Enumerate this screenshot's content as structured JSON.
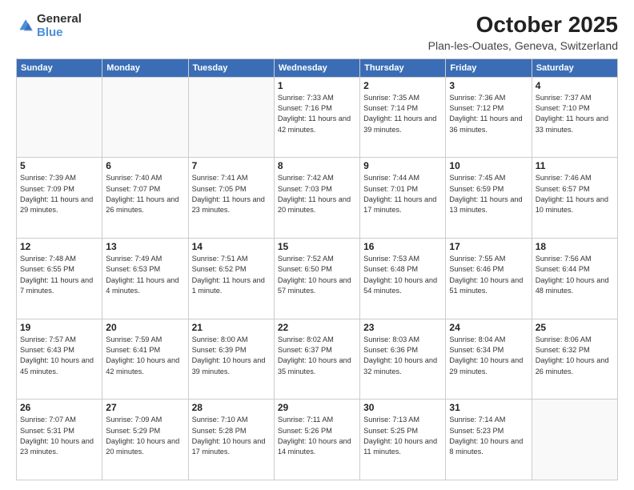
{
  "header": {
    "logo_general": "General",
    "logo_blue": "Blue",
    "month": "October 2025",
    "location": "Plan-les-Ouates, Geneva, Switzerland"
  },
  "weekdays": [
    "Sunday",
    "Monday",
    "Tuesday",
    "Wednesday",
    "Thursday",
    "Friday",
    "Saturday"
  ],
  "weeks": [
    [
      {
        "day": "",
        "info": ""
      },
      {
        "day": "",
        "info": ""
      },
      {
        "day": "",
        "info": ""
      },
      {
        "day": "1",
        "info": "Sunrise: 7:33 AM\nSunset: 7:16 PM\nDaylight: 11 hours and 42 minutes."
      },
      {
        "day": "2",
        "info": "Sunrise: 7:35 AM\nSunset: 7:14 PM\nDaylight: 11 hours and 39 minutes."
      },
      {
        "day": "3",
        "info": "Sunrise: 7:36 AM\nSunset: 7:12 PM\nDaylight: 11 hours and 36 minutes."
      },
      {
        "day": "4",
        "info": "Sunrise: 7:37 AM\nSunset: 7:10 PM\nDaylight: 11 hours and 33 minutes."
      }
    ],
    [
      {
        "day": "5",
        "info": "Sunrise: 7:39 AM\nSunset: 7:09 PM\nDaylight: 11 hours and 29 minutes."
      },
      {
        "day": "6",
        "info": "Sunrise: 7:40 AM\nSunset: 7:07 PM\nDaylight: 11 hours and 26 minutes."
      },
      {
        "day": "7",
        "info": "Sunrise: 7:41 AM\nSunset: 7:05 PM\nDaylight: 11 hours and 23 minutes."
      },
      {
        "day": "8",
        "info": "Sunrise: 7:42 AM\nSunset: 7:03 PM\nDaylight: 11 hours and 20 minutes."
      },
      {
        "day": "9",
        "info": "Sunrise: 7:44 AM\nSunset: 7:01 PM\nDaylight: 11 hours and 17 minutes."
      },
      {
        "day": "10",
        "info": "Sunrise: 7:45 AM\nSunset: 6:59 PM\nDaylight: 11 hours and 13 minutes."
      },
      {
        "day": "11",
        "info": "Sunrise: 7:46 AM\nSunset: 6:57 PM\nDaylight: 11 hours and 10 minutes."
      }
    ],
    [
      {
        "day": "12",
        "info": "Sunrise: 7:48 AM\nSunset: 6:55 PM\nDaylight: 11 hours and 7 minutes."
      },
      {
        "day": "13",
        "info": "Sunrise: 7:49 AM\nSunset: 6:53 PM\nDaylight: 11 hours and 4 minutes."
      },
      {
        "day": "14",
        "info": "Sunrise: 7:51 AM\nSunset: 6:52 PM\nDaylight: 11 hours and 1 minute."
      },
      {
        "day": "15",
        "info": "Sunrise: 7:52 AM\nSunset: 6:50 PM\nDaylight: 10 hours and 57 minutes."
      },
      {
        "day": "16",
        "info": "Sunrise: 7:53 AM\nSunset: 6:48 PM\nDaylight: 10 hours and 54 minutes."
      },
      {
        "day": "17",
        "info": "Sunrise: 7:55 AM\nSunset: 6:46 PM\nDaylight: 10 hours and 51 minutes."
      },
      {
        "day": "18",
        "info": "Sunrise: 7:56 AM\nSunset: 6:44 PM\nDaylight: 10 hours and 48 minutes."
      }
    ],
    [
      {
        "day": "19",
        "info": "Sunrise: 7:57 AM\nSunset: 6:43 PM\nDaylight: 10 hours and 45 minutes."
      },
      {
        "day": "20",
        "info": "Sunrise: 7:59 AM\nSunset: 6:41 PM\nDaylight: 10 hours and 42 minutes."
      },
      {
        "day": "21",
        "info": "Sunrise: 8:00 AM\nSunset: 6:39 PM\nDaylight: 10 hours and 39 minutes."
      },
      {
        "day": "22",
        "info": "Sunrise: 8:02 AM\nSunset: 6:37 PM\nDaylight: 10 hours and 35 minutes."
      },
      {
        "day": "23",
        "info": "Sunrise: 8:03 AM\nSunset: 6:36 PM\nDaylight: 10 hours and 32 minutes."
      },
      {
        "day": "24",
        "info": "Sunrise: 8:04 AM\nSunset: 6:34 PM\nDaylight: 10 hours and 29 minutes."
      },
      {
        "day": "25",
        "info": "Sunrise: 8:06 AM\nSunset: 6:32 PM\nDaylight: 10 hours and 26 minutes."
      }
    ],
    [
      {
        "day": "26",
        "info": "Sunrise: 7:07 AM\nSunset: 5:31 PM\nDaylight: 10 hours and 23 minutes."
      },
      {
        "day": "27",
        "info": "Sunrise: 7:09 AM\nSunset: 5:29 PM\nDaylight: 10 hours and 20 minutes."
      },
      {
        "day": "28",
        "info": "Sunrise: 7:10 AM\nSunset: 5:28 PM\nDaylight: 10 hours and 17 minutes."
      },
      {
        "day": "29",
        "info": "Sunrise: 7:11 AM\nSunset: 5:26 PM\nDaylight: 10 hours and 14 minutes."
      },
      {
        "day": "30",
        "info": "Sunrise: 7:13 AM\nSunset: 5:25 PM\nDaylight: 10 hours and 11 minutes."
      },
      {
        "day": "31",
        "info": "Sunrise: 7:14 AM\nSunset: 5:23 PM\nDaylight: 10 hours and 8 minutes."
      },
      {
        "day": "",
        "info": ""
      }
    ]
  ]
}
